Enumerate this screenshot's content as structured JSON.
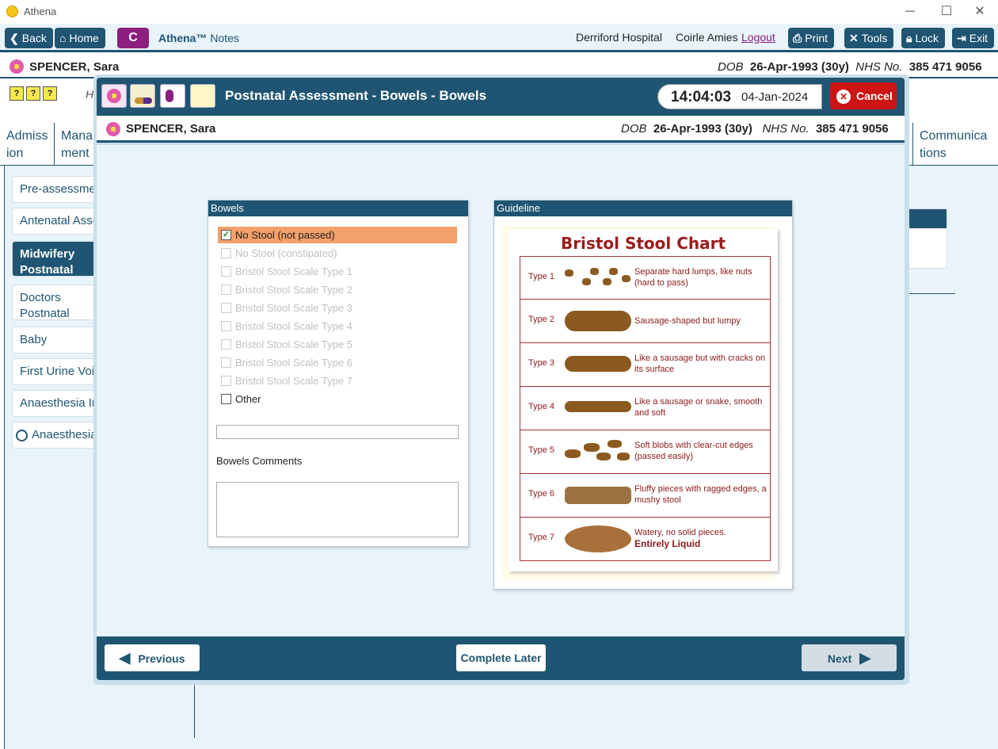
{
  "window": {
    "title": "Athena",
    "controls": [
      "─",
      "☐",
      "✕"
    ]
  },
  "toolbar": {
    "back": "Back",
    "home": "Home",
    "c_badge": "C",
    "brand_name": "Athena™",
    "brand_suffix": "Notes",
    "hospital": "Derriford Hospital",
    "user": "Coirle Amies",
    "logout": "Logout",
    "print": "Print",
    "tools": "Tools",
    "lock": "Lock",
    "exit": "Exit"
  },
  "patient": {
    "name": "SPENCER, Sara",
    "dob_label": "DOB",
    "dob": "26-Apr-1993 (30y)",
    "nhs_label": "NHS No.",
    "nhs": "385 471 9056"
  },
  "background": {
    "h_initial": "H",
    "tabs": [
      "Admiss ion",
      "Mana ment",
      "Communica tions"
    ],
    "nav": [
      "Pre-assessment",
      "Antenatal Assessments",
      "Midwifery Postnatal Assessments",
      "Doctors Postnatal Assessments",
      "Baby",
      "First Urine Void",
      "Anaesthesia In",
      "Anaesthesia"
    ]
  },
  "dialog": {
    "title": "Postnatal Assessment - Bowels - Bowels",
    "time": "14:04:03",
    "date": "04-Jan-2024",
    "cancel": "Cancel"
  },
  "bowels": {
    "header": "Bowels",
    "options": [
      {
        "label": "No Stool (not passed)",
        "checked": true,
        "enabled": true
      },
      {
        "label": "No Stool (constipated)",
        "checked": false,
        "enabled": false
      },
      {
        "label": "Bristol Stool Scale Type 1",
        "checked": false,
        "enabled": false
      },
      {
        "label": "Bristol Stool Scale Type 2",
        "checked": false,
        "enabled": false
      },
      {
        "label": "Bristol Stool Scale Type 3",
        "checked": false,
        "enabled": false
      },
      {
        "label": "Bristol Stool Scale Type 4",
        "checked": false,
        "enabled": false
      },
      {
        "label": "Bristol Stool Scale Type 5",
        "checked": false,
        "enabled": false
      },
      {
        "label": "Bristol Stool Scale Type 6",
        "checked": false,
        "enabled": false
      },
      {
        "label": "Bristol Stool Scale Type 7",
        "checked": false,
        "enabled": false
      },
      {
        "label": "Other",
        "checked": false,
        "enabled": true
      }
    ],
    "other_value": "",
    "comments_label": "Bowels Comments",
    "comments_value": ""
  },
  "guideline": {
    "header": "Guideline",
    "chart_title": "Bristol Stool Chart",
    "types": [
      {
        "label": "Type 1",
        "desc": "Separate hard lumps, like nuts (hard to pass)"
      },
      {
        "label": "Type 2",
        "desc": "Sausage-shaped but lumpy"
      },
      {
        "label": "Type 3",
        "desc": "Like a sausage but with cracks on its surface"
      },
      {
        "label": "Type 4",
        "desc": "Like a sausage or snake, smooth and soft"
      },
      {
        "label": "Type 5",
        "desc": "Soft blobs with clear-cut edges (passed easily)"
      },
      {
        "label": "Type 6",
        "desc": "Fluffy pieces with ragged edges, a mushy stool"
      },
      {
        "label": "Type 7",
        "desc": "Watery, no solid pieces.",
        "desc_bold": "Entirely Liquid"
      }
    ]
  },
  "footer": {
    "previous": "Previous",
    "complete_later": "Complete Later",
    "next": "Next"
  },
  "colors": {
    "primary": "#1f5572",
    "highlight": "#f4a06a",
    "cancel": "#cc1414",
    "accent": "#8b1e7e"
  }
}
